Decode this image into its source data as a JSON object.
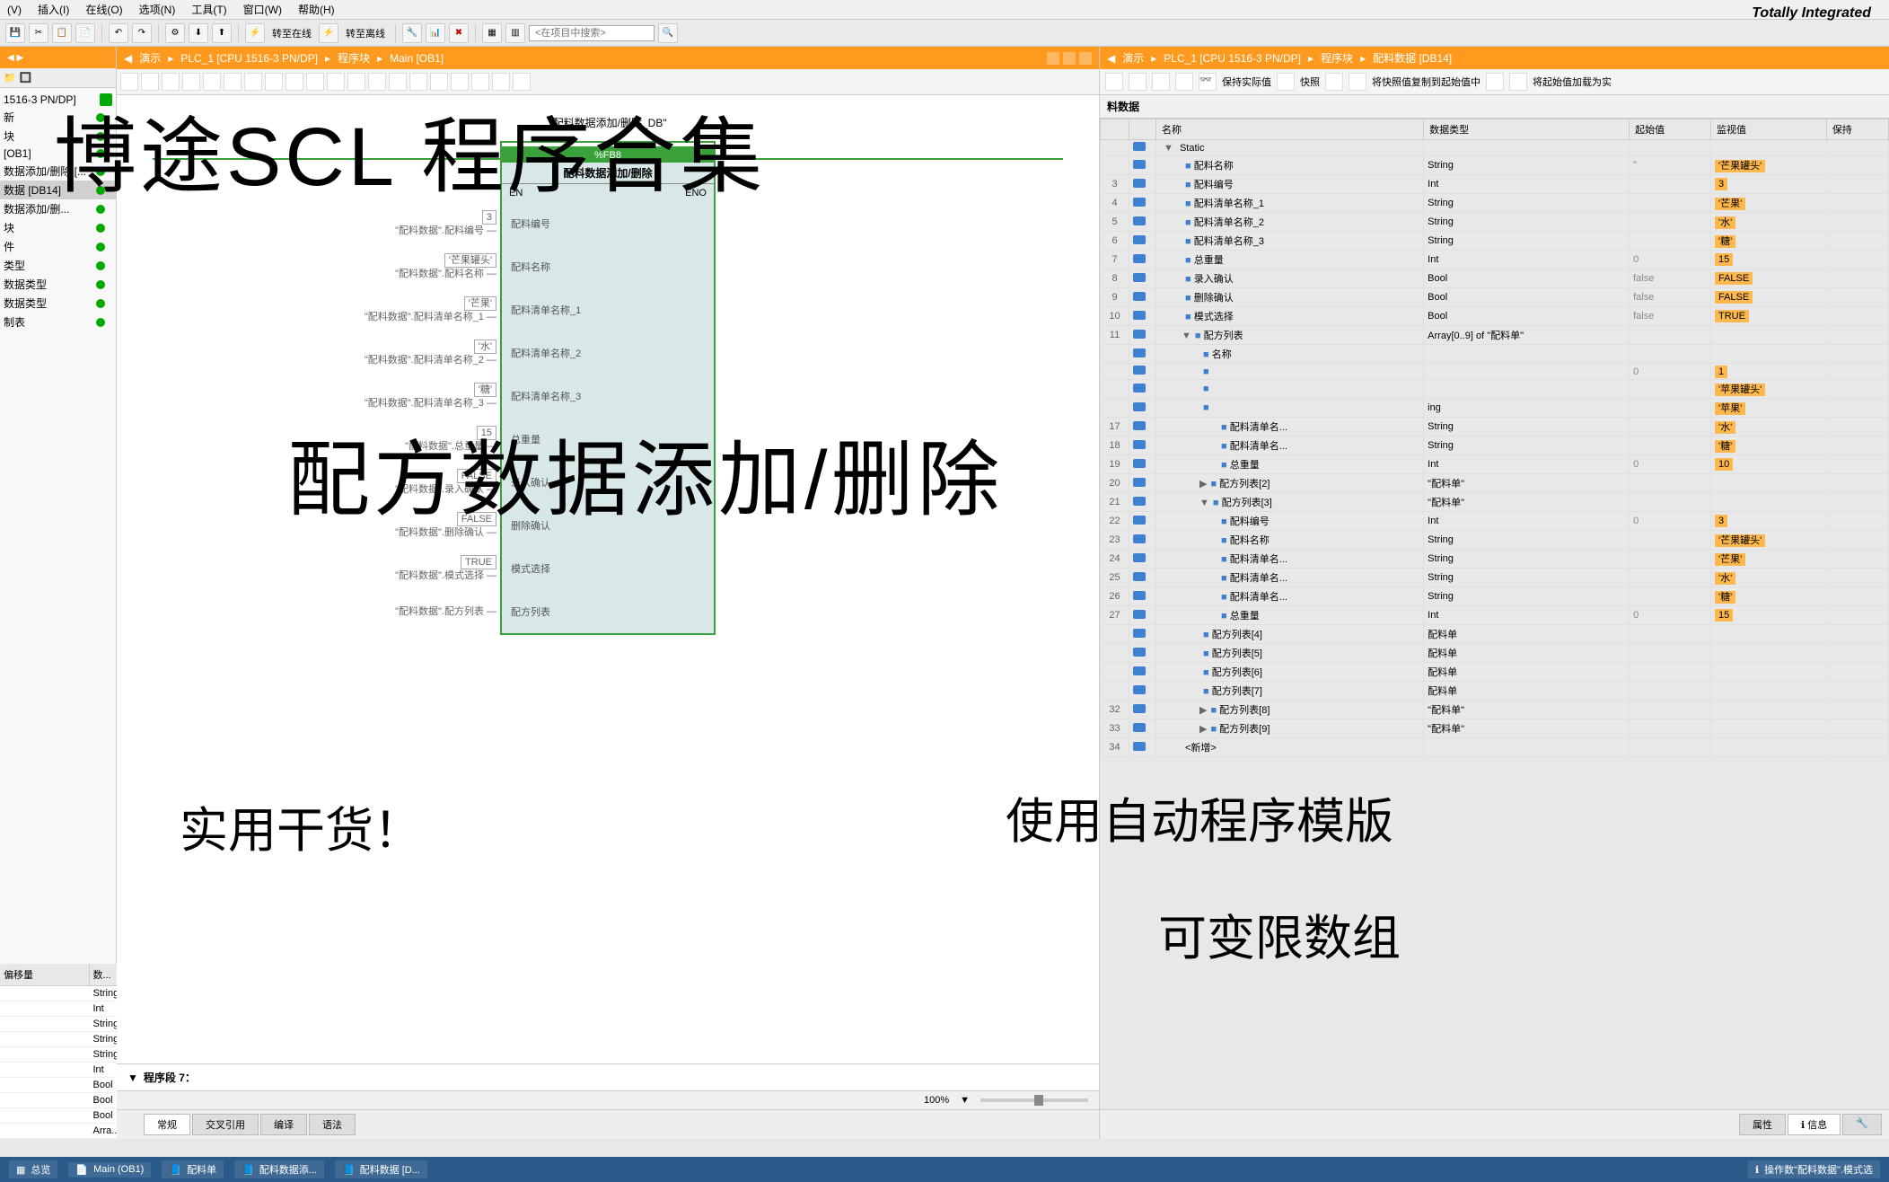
{
  "brand": "Totally Integrated",
  "menu": {
    "items": [
      "(V)",
      "插入(I)",
      "在线(O)",
      "选项(N)",
      "工具(T)",
      "窗口(W)",
      "帮助(H)"
    ]
  },
  "toolbar": {
    "go_online": "转至在线",
    "go_offline": "转至离线",
    "search_placeholder": "<在项目中搜索>"
  },
  "left_panel": {
    "device": "1516-3 PN/DP]",
    "items": [
      "新",
      "块",
      "[OB1]",
      "数据添加/删除 [...",
      "数据 [DB14]",
      "数据添加/删...",
      "块",
      "件",
      "类型",
      "数据类型",
      "数据类型",
      "制表"
    ]
  },
  "mid": {
    "breadcrumb": [
      "演示",
      "PLC_1 [CPU 1516-3 PN/DP]",
      "程序块",
      "Main [OB1]"
    ],
    "fb": {
      "db_label": "\"配料数据添加/删除_DB\"",
      "type": "%FB8",
      "title": "配料数据添加/删除",
      "en": "EN",
      "eno": "ENO",
      "inputs": [
        {
          "val": "3",
          "src": "\"配料数据\".配料编号",
          "pin": "配料编号"
        },
        {
          "val": "'芒果罐头'",
          "src": "\"配料数据\".配料名称",
          "pin": "配料名称"
        },
        {
          "val": "'芒果'",
          "src": "\"配料数据\".配料清单名称_1",
          "pin": "配料清单名称_1"
        },
        {
          "val": "'水'",
          "src": "\"配料数据\".配料清单名称_2",
          "pin": "配料清单名称_2"
        },
        {
          "val": "'糖'",
          "src": "\"配料数据\".配料清单名称_3",
          "pin": "配料清单名称_3"
        },
        {
          "val": "15",
          "src": "\"配料数据\".总重量",
          "pin": "总重量"
        },
        {
          "val": "FALSE",
          "src": "\"配料数据\".录入确认",
          "pin": "录入确认"
        },
        {
          "val": "FALSE",
          "src": "\"配料数据\".删除确认",
          "pin": "删除确认"
        },
        {
          "val": "TRUE",
          "src": "\"配料数据\".模式选择",
          "pin": "模式选择"
        },
        {
          "val": "",
          "src": "\"配料数据\".配方列表",
          "pin": "配方列表"
        }
      ]
    },
    "segment": "程序段 7：",
    "zoom": "100%"
  },
  "right": {
    "breadcrumb": [
      "演示",
      "PLC_1 [CPU 1516-3 PN/DP]",
      "程序块",
      "配料数据 [DB14]"
    ],
    "tb": {
      "keep": "保持实际值",
      "snap": "快照",
      "copy_snap": "将快照值复制到起始值中",
      "load_start": "将起始值加载为实"
    },
    "title": "料数据",
    "columns": [
      "",
      "名称",
      "数据类型",
      "起始值",
      "监视值",
      "保持"
    ],
    "rows": [
      {
        "n": "",
        "name": "Static",
        "type": "",
        "start": "",
        "mon": "",
        "lvl": 0,
        "exp": "▼",
        "mark": ""
      },
      {
        "n": "",
        "name": "配料名称",
        "type": "String",
        "start": "''",
        "mon": "'芒果罐头'",
        "lvl": 1,
        "mark": "■"
      },
      {
        "n": "3",
        "name": "配料编号",
        "type": "Int",
        "start": "",
        "mon": "3",
        "lvl": 1,
        "mark": "■"
      },
      {
        "n": "4",
        "name": "配料清单名称_1",
        "type": "String",
        "start": "",
        "mon": "'芒果'",
        "lvl": 1,
        "mark": "■"
      },
      {
        "n": "5",
        "name": "配料清单名称_2",
        "type": "String",
        "start": "",
        "mon": "'水'",
        "lvl": 1,
        "mark": "■"
      },
      {
        "n": "6",
        "name": "配料清单名称_3",
        "type": "String",
        "start": "",
        "mon": "'糖'",
        "lvl": 1,
        "mark": "■"
      },
      {
        "n": "7",
        "name": "总重量",
        "type": "Int",
        "start": "0",
        "mon": "15",
        "lvl": 1,
        "mark": "■"
      },
      {
        "n": "8",
        "name": "录入确认",
        "type": "Bool",
        "start": "false",
        "mon": "FALSE",
        "lvl": 1,
        "mark": "■"
      },
      {
        "n": "9",
        "name": "删除确认",
        "type": "Bool",
        "start": "false",
        "mon": "FALSE",
        "lvl": 1,
        "mark": "■"
      },
      {
        "n": "10",
        "name": "模式选择",
        "type": "Bool",
        "start": "false",
        "mon": "TRUE",
        "lvl": 1,
        "mark": "■"
      },
      {
        "n": "11",
        "name": "配方列表",
        "type": "Array[0..9] of \"配料单\"",
        "start": "",
        "mon": "",
        "lvl": 1,
        "exp": "▼",
        "mark": "■"
      },
      {
        "n": "",
        "name": "名称",
        "type": "",
        "start": "",
        "mon": "",
        "lvl": 2,
        "mark": "■"
      },
      {
        "n": "",
        "name": "",
        "type": "",
        "start": "0",
        "mon": "1",
        "lvl": 2,
        "mark": "■"
      },
      {
        "n": "",
        "name": "",
        "type": "",
        "start": "",
        "mon": "'苹果罐头'",
        "lvl": 2,
        "mark": "■"
      },
      {
        "n": "",
        "name": "",
        "type": "ing",
        "start": "",
        "mon": "'苹果'",
        "lvl": 2,
        "mark": "■"
      },
      {
        "n": "17",
        "name": "配料清单名...",
        "type": "String",
        "start": "",
        "mon": "'水'",
        "lvl": 3,
        "mark": "■"
      },
      {
        "n": "18",
        "name": "配料清单名...",
        "type": "String",
        "start": "",
        "mon": "'糖'",
        "lvl": 3,
        "mark": "■"
      },
      {
        "n": "19",
        "name": "总重量",
        "type": "Int",
        "start": "0",
        "mon": "10",
        "lvl": 3,
        "mark": "■"
      },
      {
        "n": "20",
        "name": "配方列表[2]",
        "type": "\"配料单\"",
        "start": "",
        "mon": "",
        "lvl": 2,
        "exp": "▶",
        "mark": "■"
      },
      {
        "n": "21",
        "name": "配方列表[3]",
        "type": "\"配料单\"",
        "start": "",
        "mon": "",
        "lvl": 2,
        "exp": "▼",
        "mark": "■"
      },
      {
        "n": "22",
        "name": "配料编号",
        "type": "Int",
        "start": "0",
        "mon": "3",
        "lvl": 3,
        "mark": "■"
      },
      {
        "n": "23",
        "name": "配料名称",
        "type": "String",
        "start": "",
        "mon": "'芒果罐头'",
        "lvl": 3,
        "mark": "■"
      },
      {
        "n": "24",
        "name": "配料清单名...",
        "type": "String",
        "start": "",
        "mon": "'芒果'",
        "lvl": 3,
        "mark": "■"
      },
      {
        "n": "25",
        "name": "配料清单名...",
        "type": "String",
        "start": "",
        "mon": "'水'",
        "lvl": 3,
        "mark": "■"
      },
      {
        "n": "26",
        "name": "配料清单名...",
        "type": "String",
        "start": "",
        "mon": "'糖'",
        "lvl": 3,
        "mark": "■"
      },
      {
        "n": "27",
        "name": "总重量",
        "type": "Int",
        "start": "0",
        "mon": "15",
        "lvl": 3,
        "mark": "■"
      },
      {
        "n": "",
        "name": "配方列表[4]",
        "type": "配料单",
        "start": "",
        "mon": "",
        "lvl": 2,
        "mark": "■"
      },
      {
        "n": "",
        "name": "配方列表[5]",
        "type": "配料单",
        "start": "",
        "mon": "",
        "lvl": 2,
        "mark": "■"
      },
      {
        "n": "",
        "name": "配方列表[6]",
        "type": "配料单",
        "start": "",
        "mon": "",
        "lvl": 2,
        "mark": "■"
      },
      {
        "n": "",
        "name": "配方列表[7]",
        "type": "配料单",
        "start": "",
        "mon": "",
        "lvl": 2,
        "mark": "■"
      },
      {
        "n": "32",
        "name": "配方列表[8]",
        "type": "\"配料单\"",
        "start": "",
        "mon": "",
        "lvl": 2,
        "exp": "▶",
        "mark": "■"
      },
      {
        "n": "33",
        "name": "配方列表[9]",
        "type": "\"配料单\"",
        "start": "",
        "mon": "",
        "lvl": 2,
        "exp": "▶",
        "mark": "■"
      },
      {
        "n": "34",
        "name": "<新增>",
        "type": "",
        "start": "",
        "mon": "",
        "lvl": 1,
        "mark": ""
      }
    ]
  },
  "bottom_left": {
    "headers": [
      "偏移量",
      "数..."
    ],
    "rows": [
      "String",
      "Int",
      "String",
      "String",
      "String",
      "Int",
      "Bool",
      "Bool",
      "Bool",
      "Arra..."
    ]
  },
  "tabs": {
    "mid": [
      "常规",
      "交叉引用",
      "编译",
      "语法"
    ],
    "right": [
      "属性",
      "信息",
      ""
    ]
  },
  "status": {
    "overview": "总览",
    "items": [
      "Main (OB1)",
      "配料单",
      "配料数据添...",
      "配料数据 [D..."
    ],
    "right": "操作数\"配料数据\".模式选"
  },
  "overlays": {
    "t1": "博途SCL 程序合集",
    "t2": "配方数据添加/删除",
    "t3": "实用干货！",
    "t4": "使用自动程序模版",
    "t5": "可变限数组"
  }
}
